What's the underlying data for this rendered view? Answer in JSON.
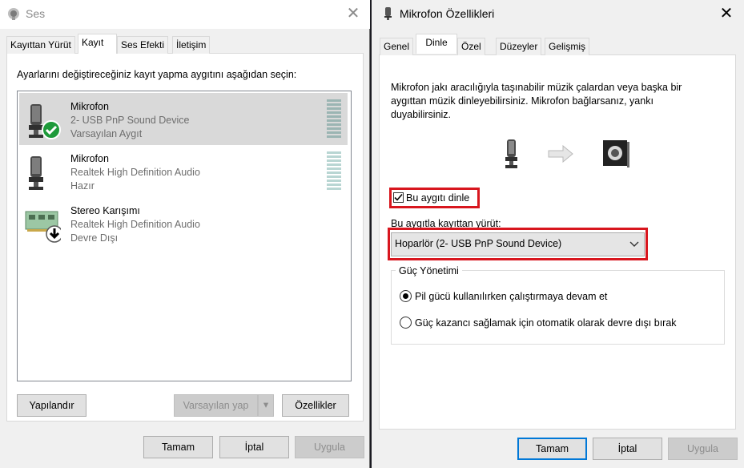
{
  "ses": {
    "title": "Ses",
    "tabs": [
      "Kayıttan Yürüt",
      "Kayıt",
      "Ses Efekti",
      "İletişim"
    ],
    "instruction": "Ayarlarını değiştireceğiniz kayıt yapma aygıtını aşağıdan seçin:",
    "devices": [
      {
        "name": "Mikrofon",
        "sub1": "2- USB PnP Sound Device",
        "sub2": "Varsayılan Aygıt",
        "icon": "microphone-default-icon"
      },
      {
        "name": "Mikrofon",
        "sub1": "Realtek High Definition Audio",
        "sub2": "Hazır",
        "icon": "microphone-icon"
      },
      {
        "name": "Stereo Karışımı",
        "sub1": "Realtek High Definition Audio",
        "sub2": "Devre Dışı",
        "icon": "sound-card-disabled-icon"
      }
    ],
    "buttons": {
      "configure": "Yapılandır",
      "set_default": "Varsayılan yap",
      "properties": "Özellikler",
      "ok": "Tamam",
      "cancel": "İptal",
      "apply": "Uygula"
    }
  },
  "mic": {
    "title": "Mikrofon Özellikleri",
    "tabs": [
      "Genel",
      "Dinle",
      "Özel",
      "Düzeyler",
      "Gelişmiş"
    ],
    "description": "Mikrofon jakı aracılığıyla taşınabilir müzik çalardan veya başka bir aygıttan müzik dinleyebilirsiniz. Mikrofon bağlarsanız, yankı duyabilirsiniz.",
    "listen_checkbox": "Bu aygıtı dinle",
    "listen_checked": true,
    "playback_label": "Bu aygıtla kayıttan yürüt:",
    "playback_device": "Hoparlör (2- USB PnP Sound Device)",
    "power_group": "Güç Yönetimi",
    "power_options": [
      "Pil gücü kullanılırken çalıştırmaya devam et",
      "Güç kazancı sağlamak için otomatik olarak devre dışı bırak"
    ],
    "power_selected": 0,
    "buttons": {
      "ok": "Tamam",
      "cancel": "İptal",
      "apply": "Uygula"
    }
  },
  "colors": {
    "highlight_red": "#d8161e",
    "focus_blue": "#0078d7",
    "check_green": "#1e9a3a"
  }
}
